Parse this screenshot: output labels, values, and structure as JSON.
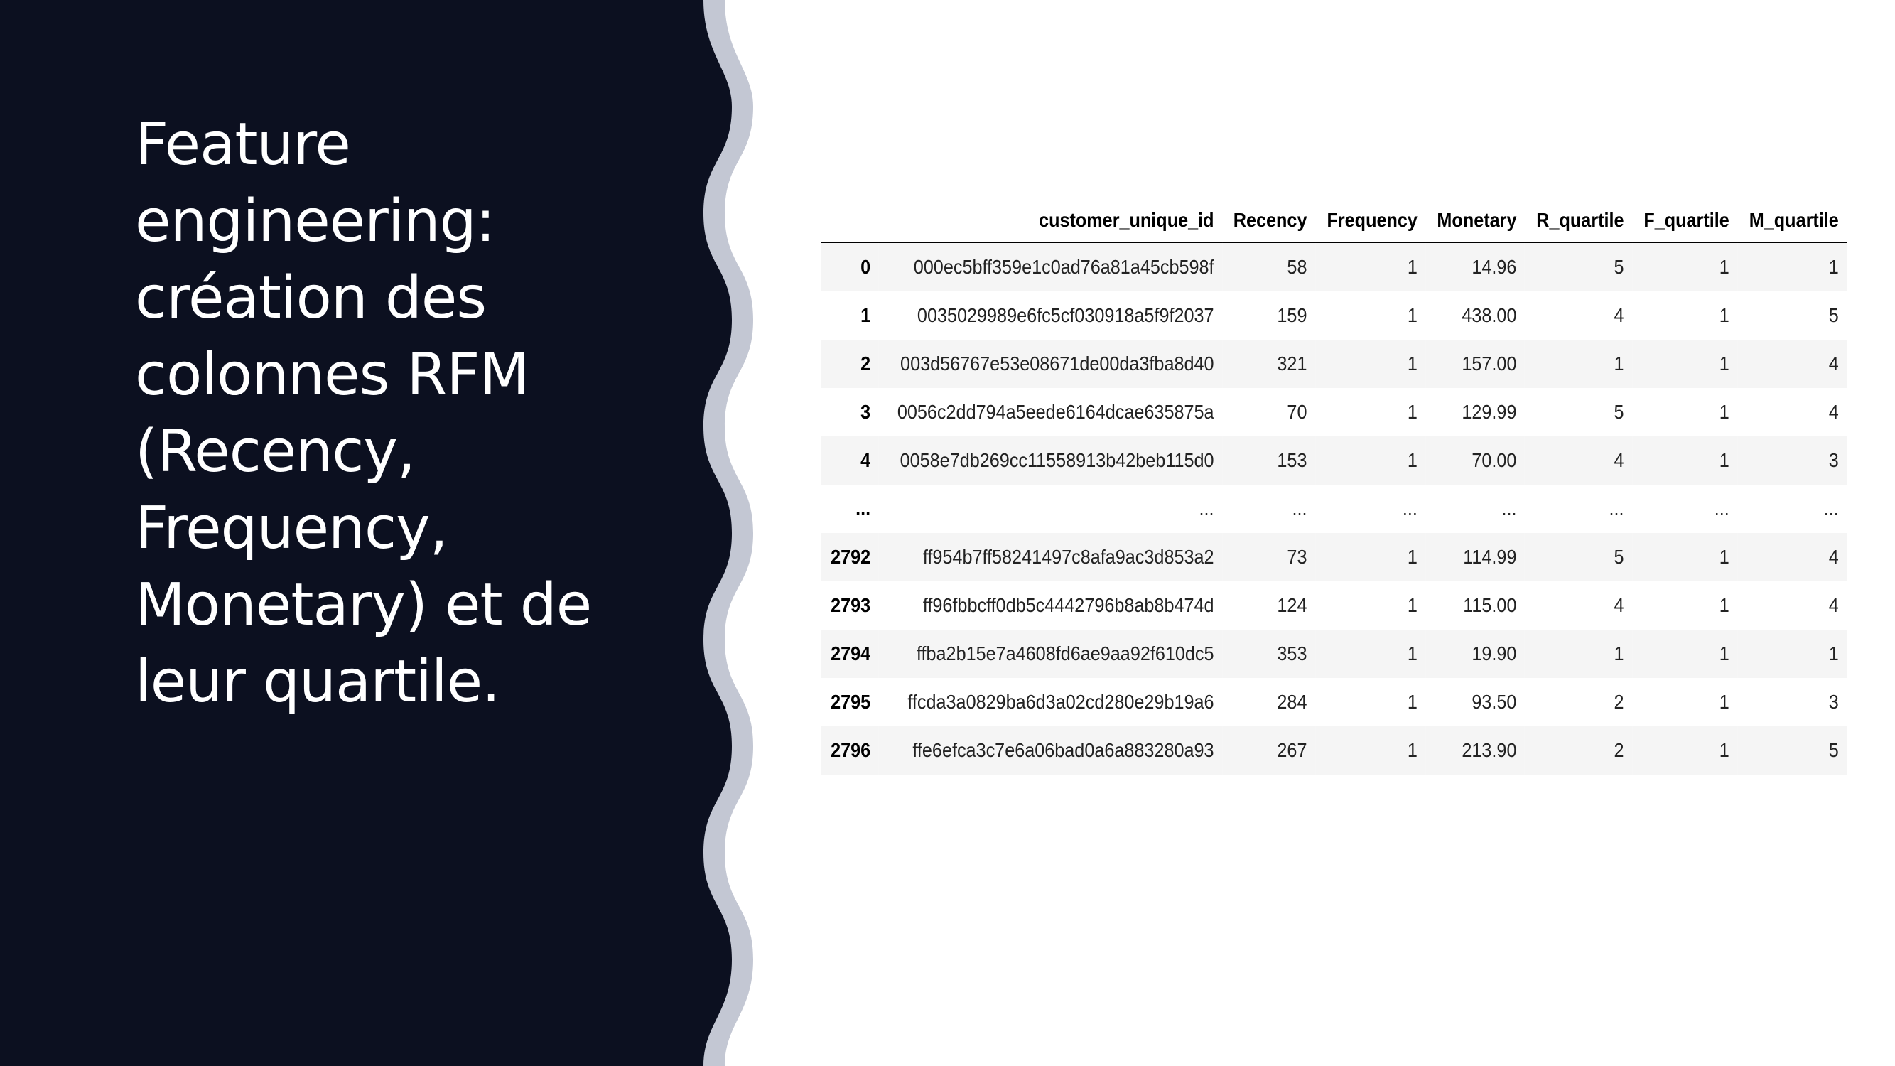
{
  "slide": {
    "title": "Feature engineering: création des colonnes RFM (Recency, Frequency, Monetary) et de leur quartile."
  },
  "colors": {
    "panel_background": "#0c1020",
    "wave_accent": "#c3c7d3",
    "slide_background": "#ffffff",
    "table_stripe": "#f5f5f5"
  },
  "table": {
    "columns": [
      "",
      "customer_unique_id",
      "Recency",
      "Frequency",
      "Monetary",
      "R_quartile",
      "F_quartile",
      "M_quartile"
    ],
    "rows": [
      [
        "0",
        "000ec5bff359e1c0ad76a81a45cb598f",
        "58",
        "1",
        "14.96",
        "5",
        "1",
        "1"
      ],
      [
        "1",
        "0035029989e6fc5cf030918a5f9f2037",
        "159",
        "1",
        "438.00",
        "4",
        "1",
        "5"
      ],
      [
        "2",
        "003d56767e53e08671de00da3fba8d40",
        "321",
        "1",
        "157.00",
        "1",
        "1",
        "4"
      ],
      [
        "3",
        "0056c2dd794a5eede6164dcae635875a",
        "70",
        "1",
        "129.99",
        "5",
        "1",
        "4"
      ],
      [
        "4",
        "0058e7db269cc11558913b42beb115d0",
        "153",
        "1",
        "70.00",
        "4",
        "1",
        "3"
      ],
      [
        "...",
        "...",
        "...",
        "...",
        "...",
        "...",
        "...",
        "..."
      ],
      [
        "2792",
        "ff954b7ff58241497c8afa9ac3d853a2",
        "73",
        "1",
        "114.99",
        "5",
        "1",
        "4"
      ],
      [
        "2793",
        "ff96fbbcff0db5c4442796b8ab8b474d",
        "124",
        "1",
        "115.00",
        "4",
        "1",
        "4"
      ],
      [
        "2794",
        "ffba2b15e7a4608fd6ae9aa92f610dc5",
        "353",
        "1",
        "19.90",
        "1",
        "1",
        "1"
      ],
      [
        "2795",
        "ffcda3a0829ba6d3a02cd280e29b19a6",
        "284",
        "1",
        "93.50",
        "2",
        "1",
        "3"
      ],
      [
        "2796",
        "ffe6efca3c7e6a06bad0a6a883280a93",
        "267",
        "1",
        "213.90",
        "2",
        "1",
        "5"
      ]
    ]
  }
}
